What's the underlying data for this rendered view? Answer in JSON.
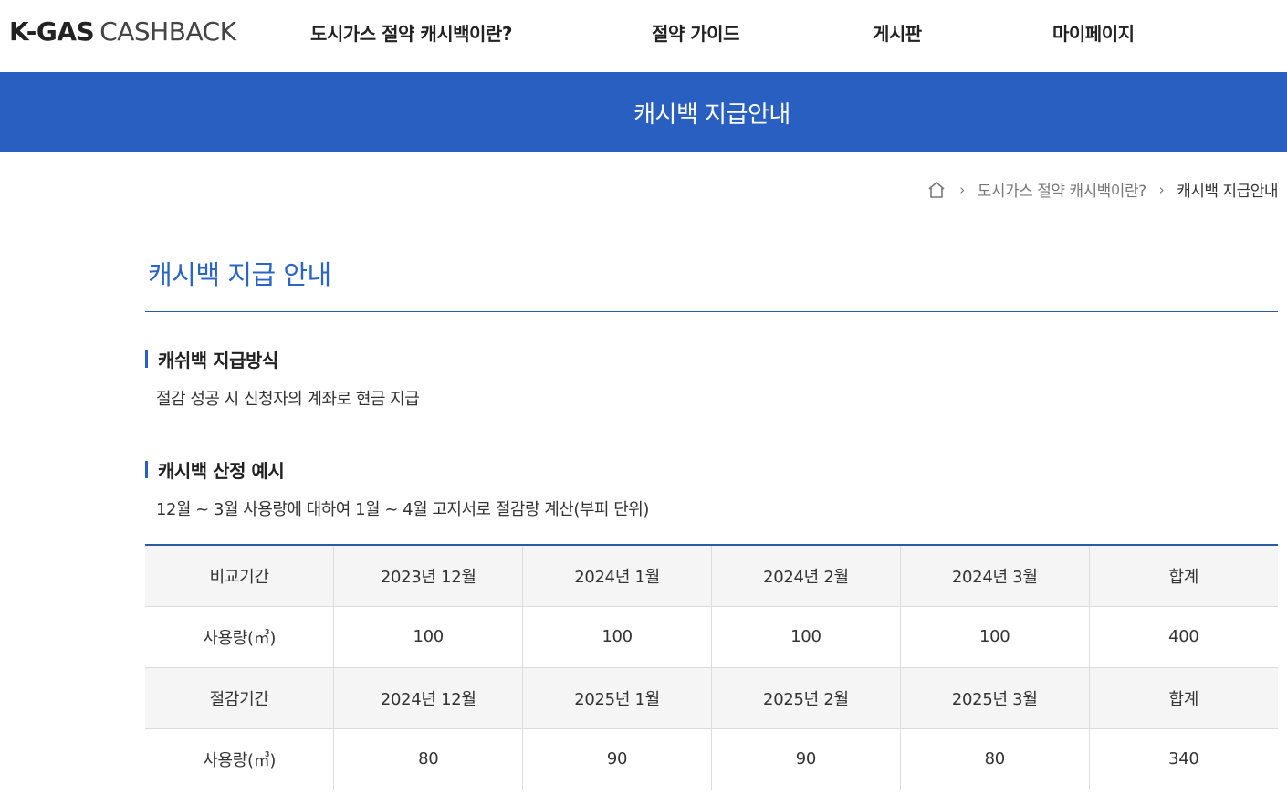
{
  "header": {
    "logo_bold": "K-GAS",
    "logo_light": "CASHBACK",
    "nav": [
      {
        "label": "도시가스 절약 캐시백이란?"
      },
      {
        "label": "절약 가이드"
      },
      {
        "label": "게시판"
      },
      {
        "label": "마이페이지"
      }
    ]
  },
  "banner": {
    "title": "캐시백 지급안내",
    "background_color": "#285fc0"
  },
  "breadcrumb": {
    "home_icon": "home-icon",
    "separator": "›",
    "items": [
      "도시가스 절약 캐시백이란?",
      "캐시백 지급안내"
    ]
  },
  "content": {
    "page_title": "캐시백 지급 안내",
    "sections": [
      {
        "heading": "캐쉬백 지급방식",
        "description": "절감 성공 시 신청자의 계좌로 현금 지급"
      },
      {
        "heading": "캐시백 산정 예시",
        "description": "12월 ~ 3월 사용량에 대하여 1월 ~ 4월 고지서로 절감량 계산(부피 단위)"
      }
    ]
  },
  "table": {
    "rows": [
      {
        "type": "header",
        "cells": [
          "비교기간",
          "2023년 12월",
          "2024년 1월",
          "2024년 2월",
          "2024년 3월",
          "합계"
        ]
      },
      {
        "type": "value",
        "cells": [
          "사용량(㎥)",
          "100",
          "100",
          "100",
          "100",
          "400"
        ]
      },
      {
        "type": "header",
        "cells": [
          "절감기간",
          "2024년 12월",
          "2025년 1월",
          "2025년 2월",
          "2025년 3월",
          "합계"
        ]
      },
      {
        "type": "value",
        "cells": [
          "사용량(㎥)",
          "80",
          "90",
          "90",
          "80",
          "340"
        ]
      }
    ]
  },
  "colors": {
    "accent": "#285fc0",
    "title_blue": "#2b65c4",
    "rule": "#2c5a9e"
  }
}
